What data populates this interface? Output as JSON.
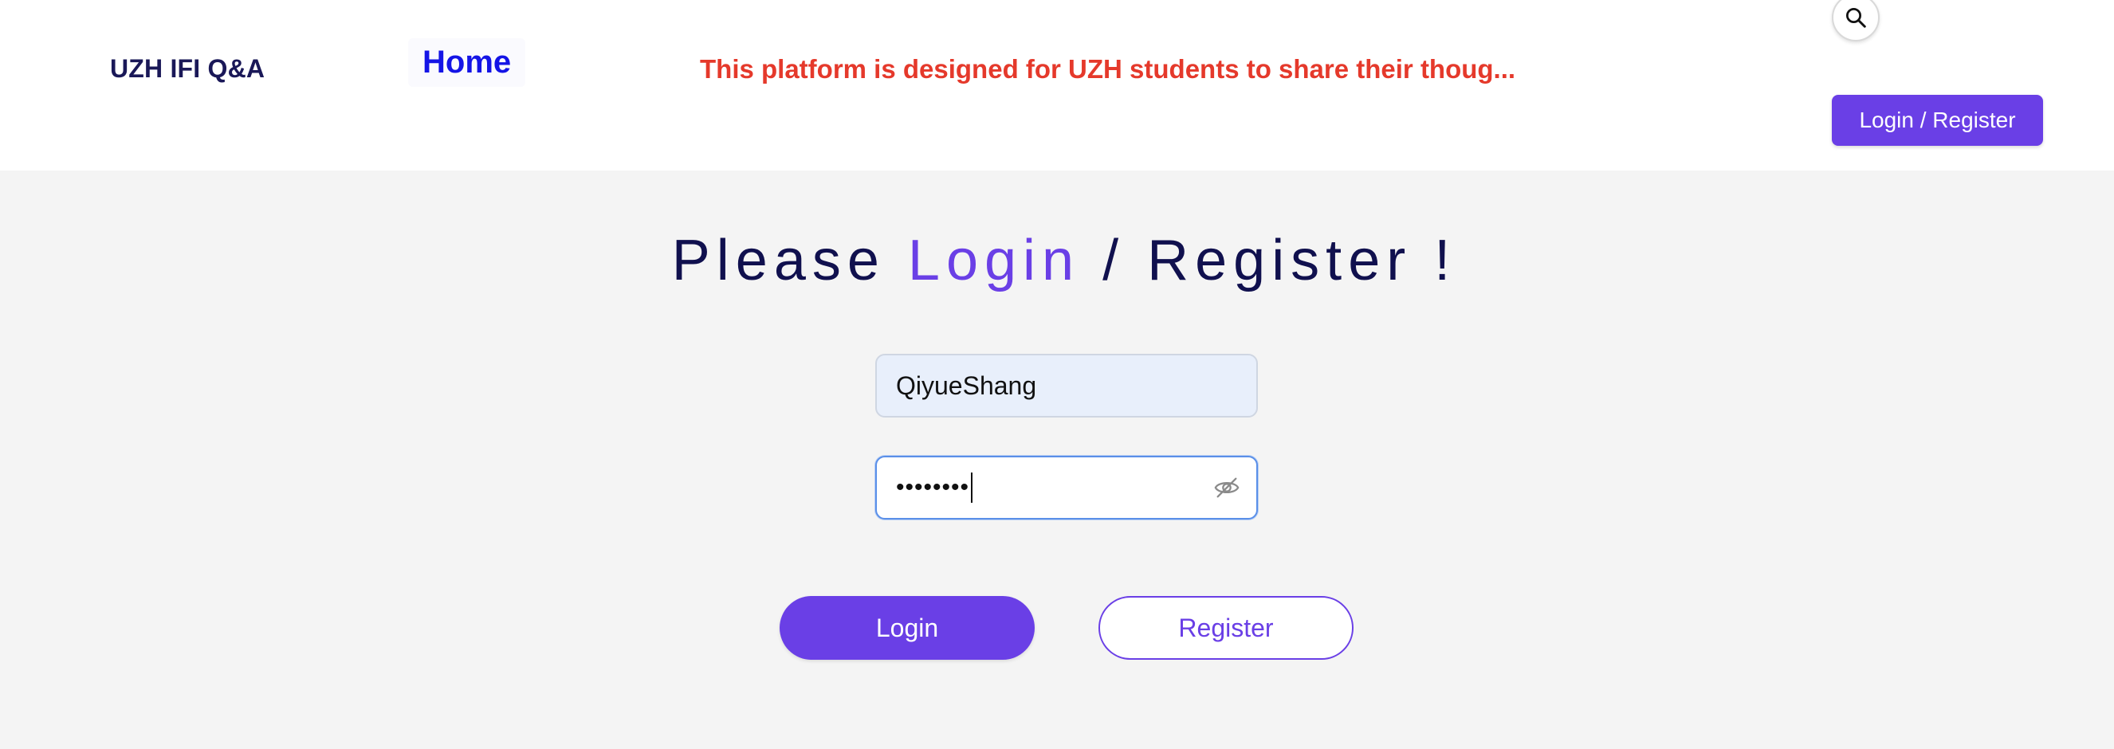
{
  "header": {
    "brand": "UZH IFI Q&A",
    "nav_home": "Home",
    "announcement": "This platform is designed for UZH students to share their thoug...",
    "search_icon": "search-icon",
    "login_register_label": "Login / Register"
  },
  "main": {
    "heading_prefix": "Please ",
    "heading_accent": "Login",
    "heading_suffix": " / Register !",
    "username_value": "QiyueShang",
    "password_masked": "••••••••",
    "password_toggle_icon": "eye-off-icon",
    "login_button": "Login",
    "register_button": "Register"
  },
  "colors": {
    "accent": "#6a3fe6",
    "announcement": "#e5392b",
    "nav_link": "#1414e6",
    "heading": "#10104e"
  }
}
